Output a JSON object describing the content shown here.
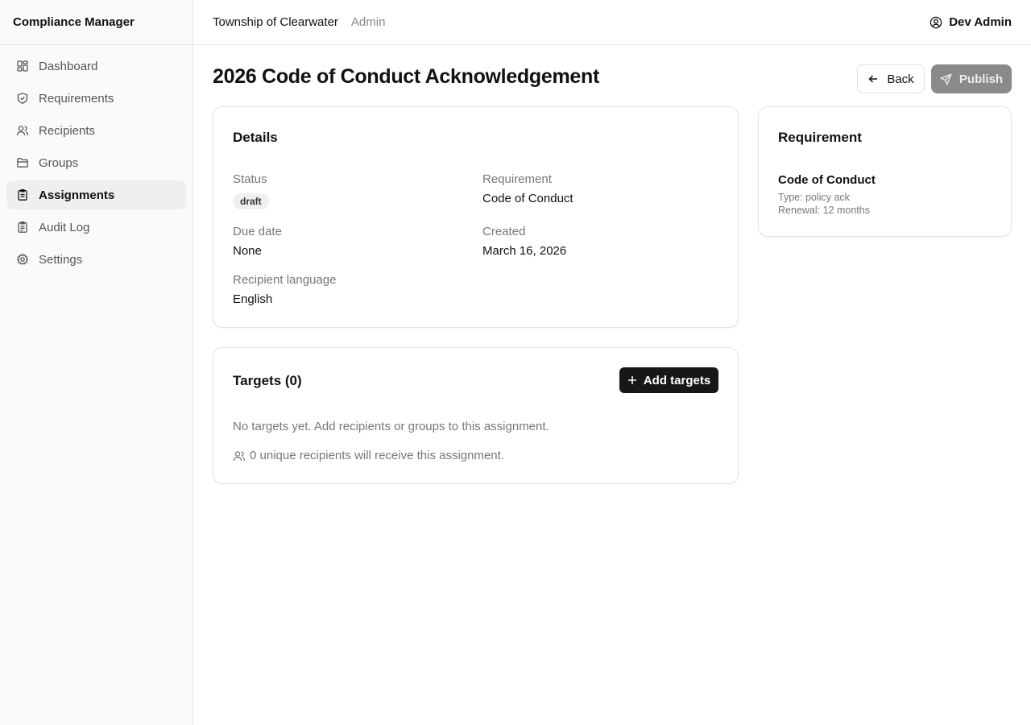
{
  "app": {
    "title": "Compliance Manager"
  },
  "sidebar": {
    "items": [
      {
        "label": "Dashboard",
        "icon": "dashboard-icon",
        "active": false
      },
      {
        "label": "Requirements",
        "icon": "shield-icon",
        "active": false
      },
      {
        "label": "Recipients",
        "icon": "users-icon",
        "active": false
      },
      {
        "label": "Groups",
        "icon": "folder-icon",
        "active": false
      },
      {
        "label": "Assignments",
        "icon": "clipboard-icon",
        "active": true
      },
      {
        "label": "Audit Log",
        "icon": "clipboard-list-icon",
        "active": false
      },
      {
        "label": "Settings",
        "icon": "gear-icon",
        "active": false
      }
    ]
  },
  "header": {
    "org": "Township of Clearwater",
    "role": "Admin",
    "user": "Dev Admin"
  },
  "page": {
    "title": "2026 Code of Conduct Acknowledgement",
    "back_label": "Back",
    "publish_label": "Publish"
  },
  "details": {
    "title": "Details",
    "status_label": "Status",
    "status_value": "draft",
    "requirement_label": "Requirement",
    "requirement_value": "Code of Conduct",
    "due_label": "Due date",
    "due_value": "None",
    "created_label": "Created",
    "created_value": "March 16, 2026",
    "language_label": "Recipient language",
    "language_value": "English"
  },
  "requirement_card": {
    "title": "Requirement",
    "name": "Code of Conduct",
    "type": "Type: policy ack",
    "renewal": "Renewal: 12 months"
  },
  "targets": {
    "title": "Targets (0)",
    "add_label": "Add targets",
    "empty_text": "No targets yet. Add recipients or groups to this assignment.",
    "count_text": "0 unique recipients will receive this assignment."
  },
  "colors": {
    "accent_dark": "#171717",
    "publish_disabled": "#8a8a8a",
    "active_nav_bg": "#efefef"
  }
}
